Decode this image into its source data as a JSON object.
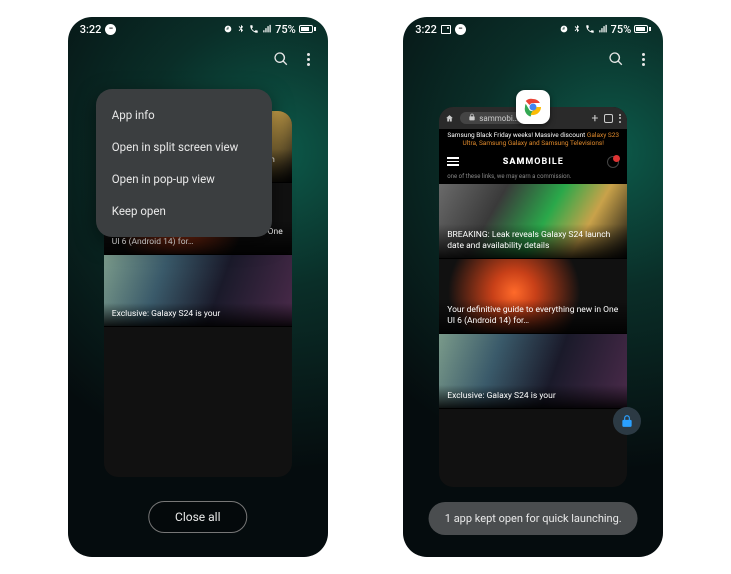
{
  "statusbar": {
    "time": "3:22",
    "battery_pct": "75%"
  },
  "left_phone": {
    "context_menu": {
      "items": [
        "App info",
        "Open in split screen view",
        "Open in pop-up view",
        "Keep open"
      ]
    },
    "close_all_label": "Close all"
  },
  "right_phone": {
    "toast": "1 app kept open for quick launching."
  },
  "app_card": {
    "url_host": "sammobi…",
    "banner_prefix": "Samsung Black Friday weeks! Massive discount ",
    "banner_hl": "Galaxy S23 Ultra, Samsung Galaxy and Samsung Televisions!",
    "brand_left": "SAM",
    "brand_right": "MOBILE",
    "subline": "one of these links, we may earn a commission.",
    "articles": [
      "BREAKING: Leak reveals Galaxy S24 launch date and availability details",
      "Your definitive guide to everything new in One UI 6 (Android 14) for…",
      "Exclusive: Galaxy S24 is your"
    ]
  }
}
